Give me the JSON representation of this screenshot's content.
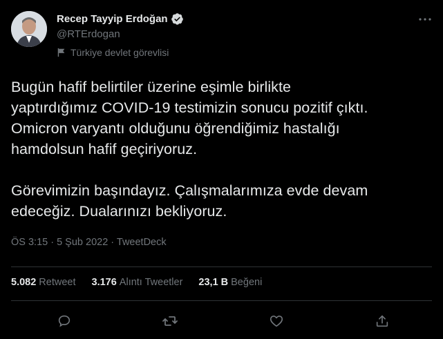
{
  "author": {
    "display_name": "Recep Tayyip Erdoğan",
    "handle": "@RTErdogan",
    "label": "Türkiye devlet görevlisi"
  },
  "tweet": {
    "text": "Bugün hafif belirtiler üzerine eşimle birlikte\nyaptırdığımız COVID-19 testimizin sonucu pozitif çıktı.\nOmicron varyantı olduğunu öğrendiğimiz hastalığı\nhamdolsun hafif geçiriyoruz.\n\nGörevimizin başındayız. Çalışmalarımıza evde devam\nedeceğiz. Dualarınızı bekliyoruz.",
    "meta": "ÖS 3:15 · 5 Şub 2022 · TweetDeck"
  },
  "stats": {
    "retweets_count": "5.082",
    "retweets_label": "Retweet",
    "quotes_count": "3.176",
    "quotes_label": "Alıntı Tweetler",
    "likes_count": "23,1 B",
    "likes_label": "Beğeni"
  },
  "icons": {
    "verified": "verified-badge-icon",
    "label": "flag-icon",
    "more": "more-icon",
    "reply": "reply-icon",
    "retweet": "retweet-icon",
    "like": "heart-icon",
    "share": "share-icon"
  },
  "colors": {
    "background": "#000000",
    "text": "#e7e9ea",
    "secondary": "#71767b",
    "divider": "#2f3336"
  }
}
